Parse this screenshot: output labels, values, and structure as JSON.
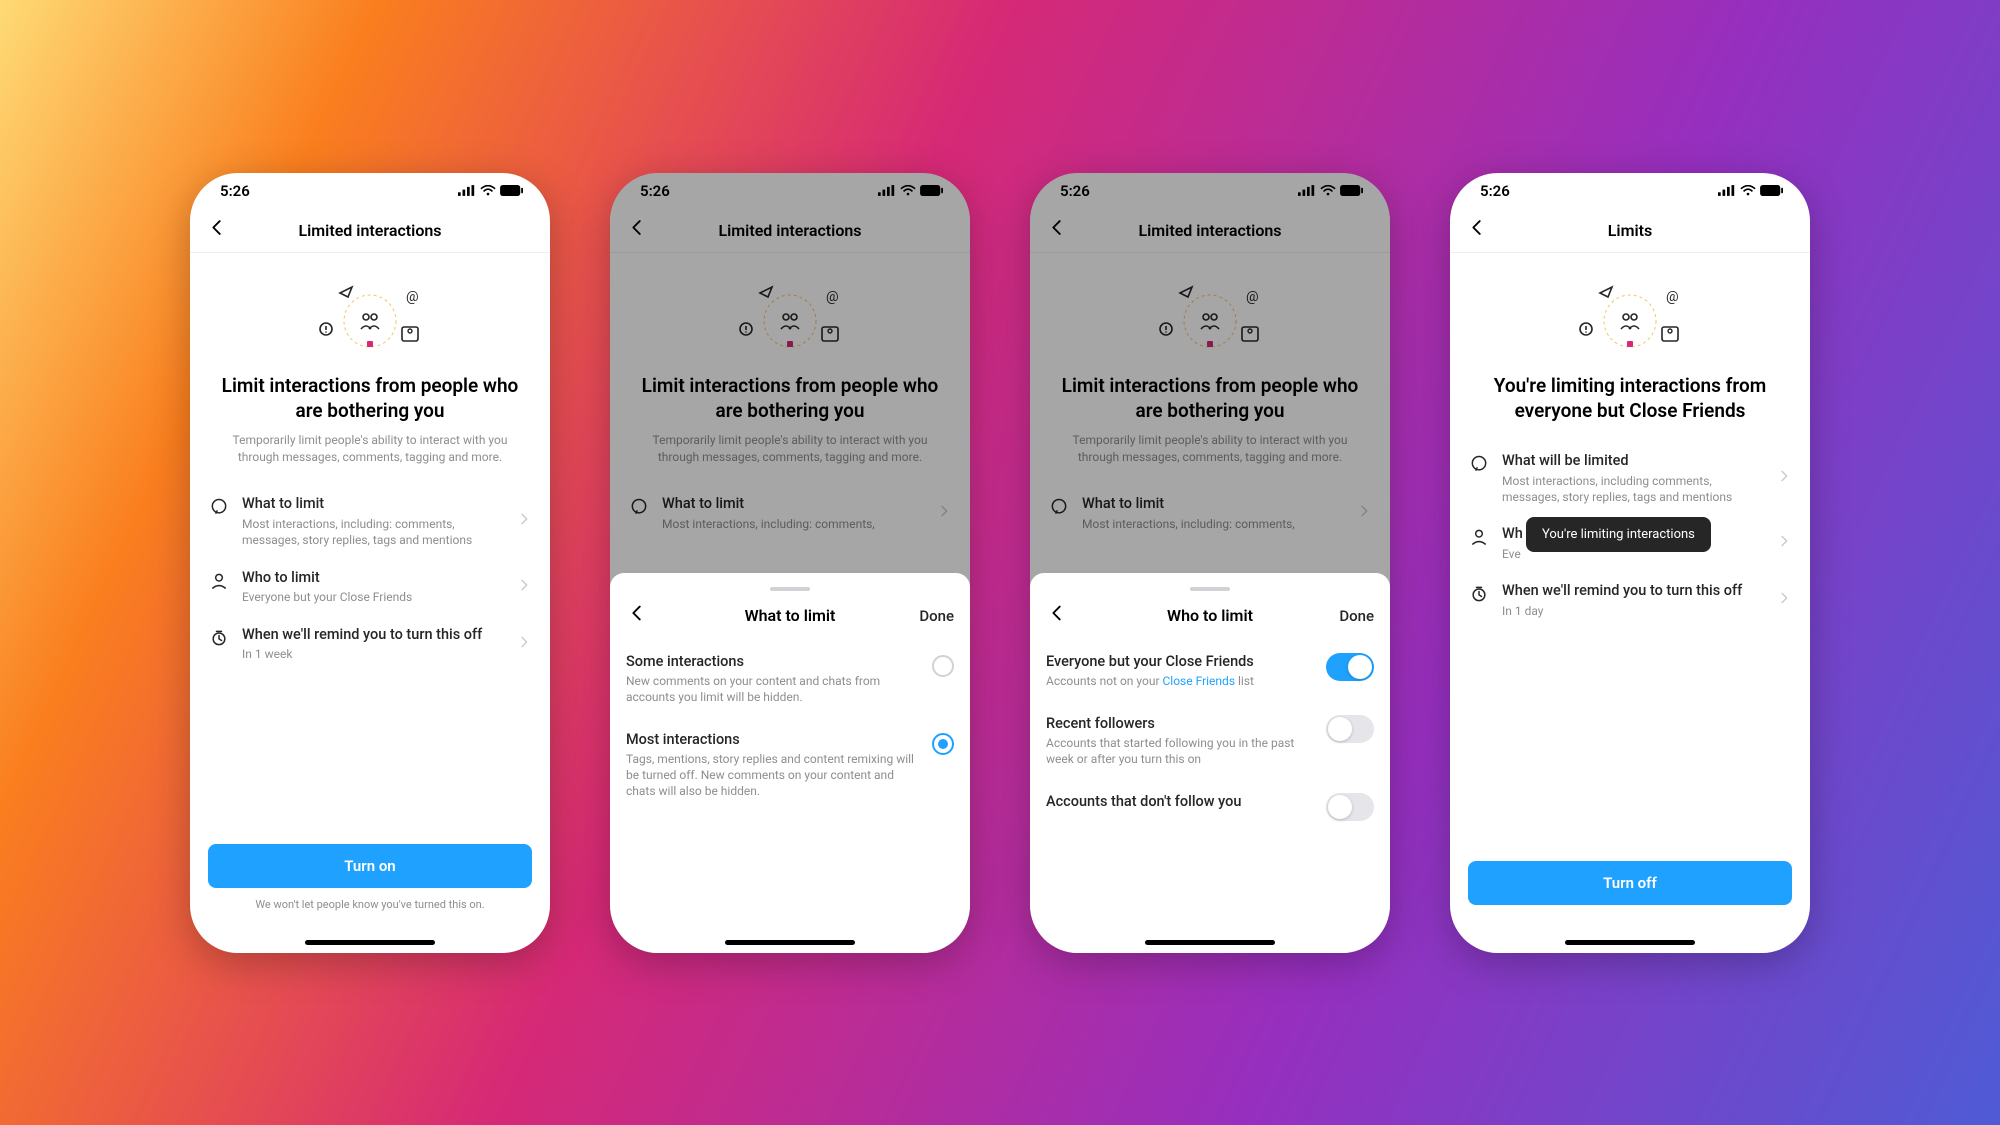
{
  "status": {
    "time": "5:26"
  },
  "screen1": {
    "title": "Limited interactions",
    "heading": "Limit interactions from people who are bothering you",
    "sub": "Temporarily limit people's ability to interact with you through messages, comments, tagging and more.",
    "rows": [
      {
        "title": "What to limit",
        "desc": "Most interactions, including: comments, messages, story replies, tags and mentions"
      },
      {
        "title": "Who to limit",
        "desc": "Everyone but your Close Friends"
      },
      {
        "title": "When we'll remind you to turn this off",
        "desc": "In 1 week"
      }
    ],
    "button": "Turn on",
    "footer": "We won't let people know you've turned this on."
  },
  "screen2": {
    "title": "Limited interactions",
    "heading": "Limit interactions from people who are bothering you",
    "sub": "Temporarily limit people's ability to interact with you through messages, comments, tagging and more.",
    "row_what_title": "What to limit",
    "row_what_desc": "Most interactions, including: comments,",
    "sheet": {
      "title": "What to limit",
      "done": "Done",
      "options": [
        {
          "title": "Some interactions",
          "desc": "New comments on your content and chats from accounts you limit will be hidden.",
          "selected": false
        },
        {
          "title": "Most interactions",
          "desc": "Tags, mentions, story replies and content remixing will be turned off. New comments on your content and chats will also be hidden.",
          "selected": true
        }
      ]
    }
  },
  "screen3": {
    "title": "Limited interactions",
    "heading": "Limit interactions from people who are bothering you",
    "sub": "Temporarily limit people's ability to interact with you through messages, comments, tagging and more.",
    "row_what_title": "What to limit",
    "row_what_desc": "Most interactions, including: comments,",
    "sheet": {
      "title": "Who to limit",
      "done": "Done",
      "options": [
        {
          "title": "Everyone but your Close Friends",
          "desc_pre": "Accounts not on your ",
          "desc_link": "Close Friends",
          "desc_post": " list",
          "on": true
        },
        {
          "title": "Recent followers",
          "desc": "Accounts that started following you in the past week or after you turn this on",
          "on": false
        },
        {
          "title": "Accounts that don't follow you",
          "desc": "",
          "on": false
        }
      ]
    }
  },
  "screen4": {
    "title": "Limits",
    "heading": "You're limiting interactions from everyone but Close Friends",
    "rows": [
      {
        "title": "What will be limited",
        "desc": "Most interactions, including comments, messages, story replies, tags and mentions"
      },
      {
        "title": "Wh",
        "desc": "Eve"
      },
      {
        "title": "When we'll remind you to turn this off",
        "desc": "In 1 day"
      }
    ],
    "toast": "You're limiting interactions",
    "button": "Turn off"
  }
}
